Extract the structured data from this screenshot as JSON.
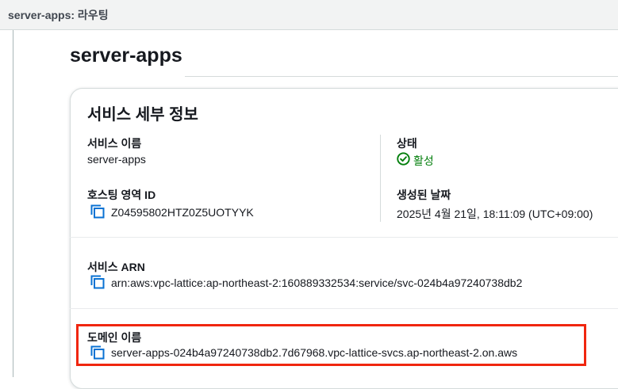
{
  "topbar": {
    "title": "server-apps: 라우팅"
  },
  "page": {
    "title": "server-apps"
  },
  "panel": {
    "title": "서비스 세부 정보",
    "service_name": {
      "label": "서비스 이름",
      "value": "server-apps"
    },
    "status": {
      "label": "상태",
      "value": "활성",
      "icon": "check-circle-icon",
      "color": "#037f0c"
    },
    "hosted_zone_id": {
      "label": "호스팅 영역 ID",
      "value": "Z04595802HTZ0Z5UOTYYK",
      "icon": "copy-icon"
    },
    "created": {
      "label": "생성된 날짜",
      "value": "2025년 4월 21일, 18:11:09 (UTC+09:00)"
    },
    "service_arn": {
      "label": "서비스 ARN",
      "value": "arn:aws:vpc-lattice:ap-northeast-2:160889332534:service/svc-024b4a97240738db2",
      "icon": "copy-icon"
    },
    "domain_name": {
      "label": "도메인 이름",
      "value": "server-apps-024b4a97240738db2.7d67968.vpc-lattice-svcs.ap-northeast-2.on.aws",
      "icon": "copy-icon"
    }
  },
  "colors": {
    "accent": "#0972d3",
    "highlight": "#f0260f",
    "success": "#037f0c"
  }
}
